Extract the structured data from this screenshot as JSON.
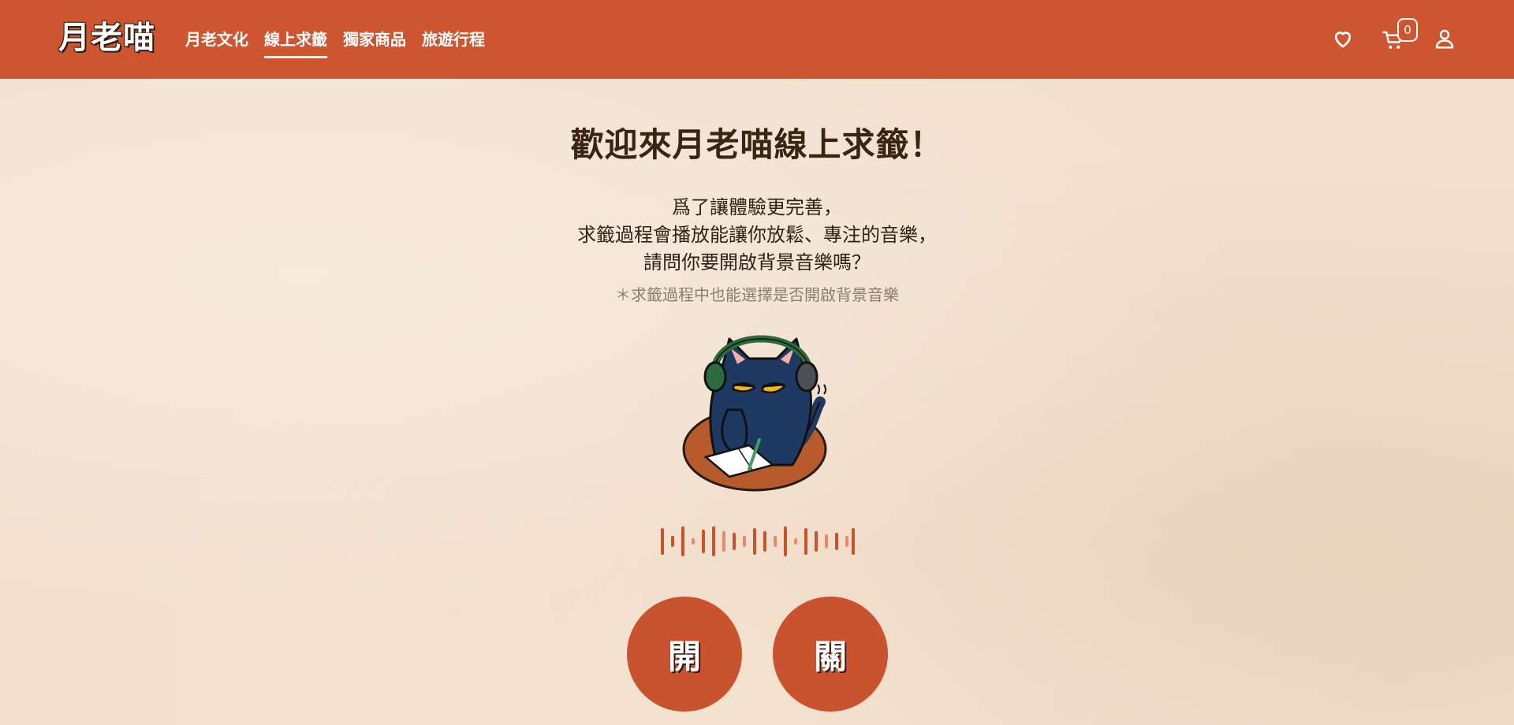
{
  "header": {
    "logo": "月老喵",
    "nav": [
      {
        "label": "月老文化",
        "active": false
      },
      {
        "label": "線上求籤",
        "active": true
      },
      {
        "label": "獨家商品",
        "active": false
      },
      {
        "label": "旅遊行程",
        "active": false
      }
    ],
    "icons": [
      "heart-icon",
      "cart-icon",
      "user-icon"
    ],
    "cart_count": "0"
  },
  "main": {
    "title": "歡迎來月老喵線上求籤！",
    "description_lines": [
      "爲了讓體驗更完善，",
      "求籤過程會播放能讓你放鬆、專注的音樂，",
      "請問你要開啟背景音樂嗎？"
    ],
    "note": "＊求籤過程中也能選擇是否開啟背景音樂",
    "buttons": {
      "on_label": "開",
      "off_label": "關"
    }
  },
  "colors": {
    "brand": "#cd5530",
    "background": "#f2e0cd",
    "text_dark": "#3a2414"
  }
}
